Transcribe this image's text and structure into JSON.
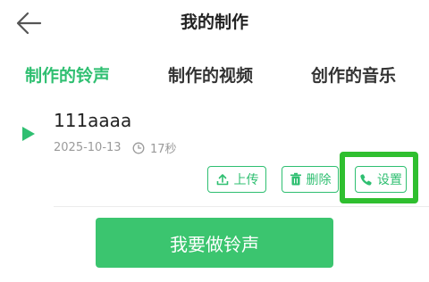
{
  "header": {
    "title": "我的制作",
    "back_icon": "back-arrow-icon"
  },
  "tabs": [
    {
      "label": "制作的铃声",
      "active": true
    },
    {
      "label": "制作的视频",
      "active": false
    },
    {
      "label": "创作的音乐",
      "active": false
    }
  ],
  "ringtone": {
    "title": "111aaaa",
    "date": "2025-10-13",
    "duration": "17秒",
    "actions": {
      "upload_label": "上传",
      "delete_label": "删除",
      "set_label": "设置"
    }
  },
  "make_button_label": "我要做铃声",
  "colors": {
    "accent": "#2fbf71",
    "button_bg": "#3bc56f",
    "highlight": "#2fbf2f",
    "muted_text": "#9a9a9a"
  }
}
